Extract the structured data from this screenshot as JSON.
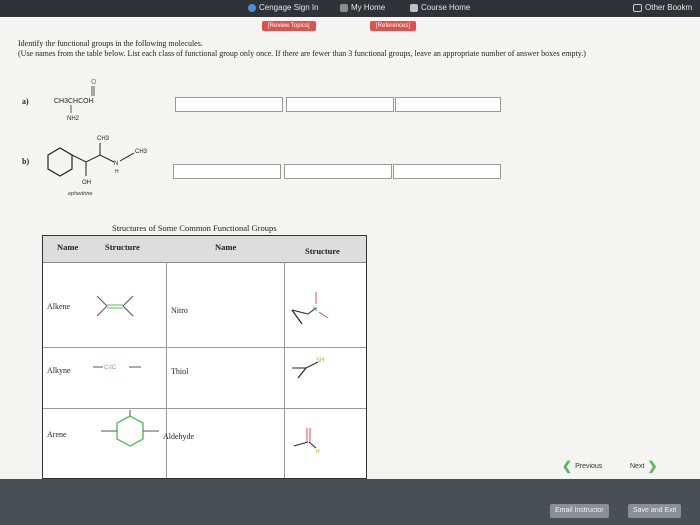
{
  "bookmarks": {
    "items": [
      {
        "label": "Cengage Sign In"
      },
      {
        "label": "My Home"
      },
      {
        "label": "Course Home"
      }
    ],
    "other": "Other Bookm"
  },
  "toolbar": {
    "review_topics": "[Review Topics]",
    "references": "[References]"
  },
  "question": {
    "instruction_line1": "Identify the functional groups in the following molecules.",
    "instruction_line2": "(Use names from the table below. List each class of functional group only once. If there are fewer than 3 functional groups, leave an appropriate number of answer boxes empty.)",
    "parts": [
      {
        "label": "a)",
        "formula": "CH3CHCOH",
        "substituent": "NH2",
        "carbonyl": "O",
        "answers": [
          "",
          "",
          ""
        ]
      },
      {
        "label": "b)",
        "name": "ephedrine",
        "methyl1": "CH3",
        "methyl2": "CH3",
        "nh": "N",
        "h": "H",
        "oh": "OH",
        "answers": [
          "",
          "",
          ""
        ]
      }
    ]
  },
  "table": {
    "caption": "Structures of Some Common Functional Groups",
    "headers": [
      "Name",
      "Structure",
      "Name",
      "Structure"
    ],
    "rows": [
      {
        "name1": "Alkene",
        "name2": "Nitro",
        "s2_label": "N"
      },
      {
        "name1": "Alkyne",
        "s1_label": "C≡C",
        "name2": "Thiol",
        "s2_label": "SH"
      },
      {
        "name1": "Arene",
        "name2": "Aldehyde",
        "s2_label": "H"
      }
    ]
  },
  "nav": {
    "previous": "Previous",
    "next": "Next"
  },
  "footer": {
    "email": "Email Instructor",
    "save": "Save and Exit"
  },
  "colors": {
    "red": "#d9534f",
    "green": "#5cb85c",
    "page": "#f4f4f2"
  }
}
